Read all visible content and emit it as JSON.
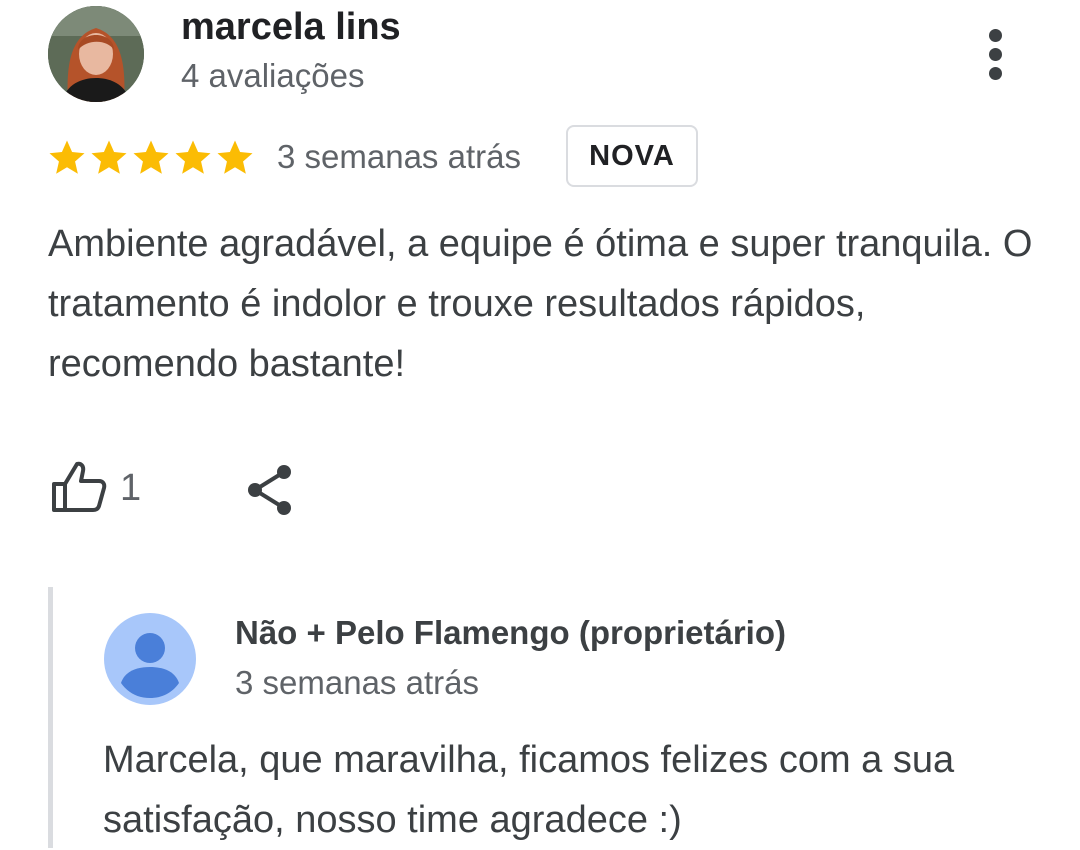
{
  "review": {
    "reviewer_name": "marcela lins",
    "reviewer_count": "4 avaliações",
    "rating": 5,
    "rating_max": 5,
    "star_color": "#fbbc04",
    "time_ago": "3 semanas atrás",
    "badge": "NOVA",
    "text": "Ambiente agradável, a equipe é ótima e super tranquila. O tratamento é indolor e trouxe resultados rápidos, recomendo bastante!",
    "like_count": "1",
    "icons": {
      "more": "more-vert-icon",
      "like": "thumb-up-icon",
      "share": "share-icon"
    }
  },
  "reply": {
    "owner_name": "Não + Pelo Flamengo (proprietário)",
    "time_ago": "3 semanas atrás",
    "text": "Marcela, que maravilha, ficamos felizes com a sua satisfação, nosso time agradece :)",
    "avatar_color": "#a8c7fa",
    "avatar_icon_color": "#4a7fd9"
  }
}
